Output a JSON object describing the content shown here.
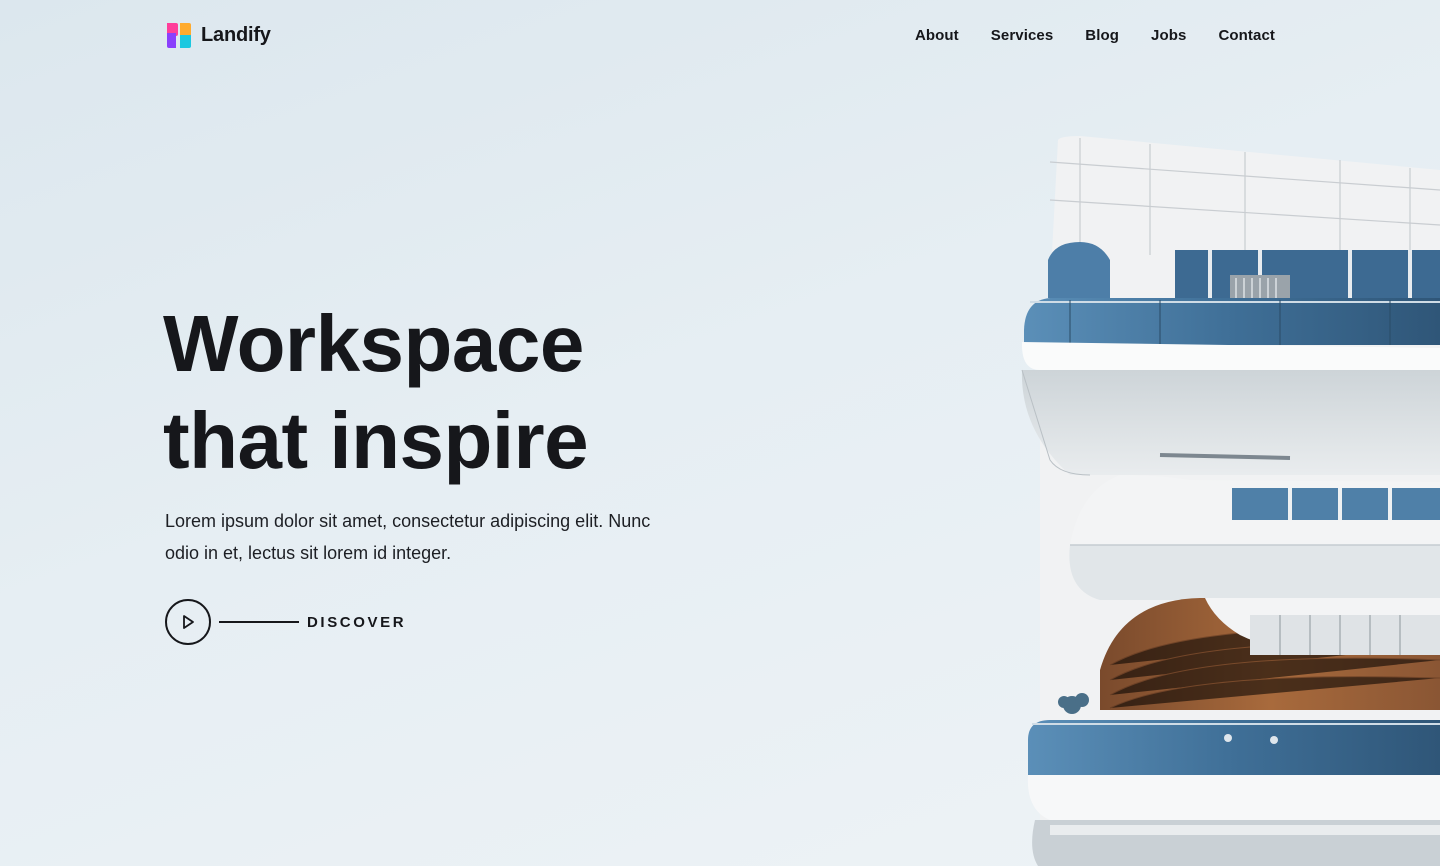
{
  "brand": {
    "name": "Landify",
    "logo_icon": "landify-logo-icon"
  },
  "nav": {
    "items": [
      {
        "label": "About"
      },
      {
        "label": "Services"
      },
      {
        "label": "Blog"
      },
      {
        "label": "Jobs"
      },
      {
        "label": "Contact"
      }
    ]
  },
  "hero": {
    "title_line1": "Workspace",
    "title_line2": "that inspire",
    "description": "Lorem ipsum dolor sit amet, consectetur adipiscing elit. Nunc odio in et, lectus sit lorem id integer.",
    "cta_label": "DISCOVER",
    "cta_icon": "play-icon"
  },
  "image": {
    "subject": "building-photo"
  },
  "colors": {
    "text": "#16171b",
    "background": "#e6eef3",
    "logo_pink": "#ff3d9a",
    "logo_purple": "#8a3ffc",
    "logo_orange": "#ffab2e",
    "logo_cyan": "#1cc8e0"
  }
}
